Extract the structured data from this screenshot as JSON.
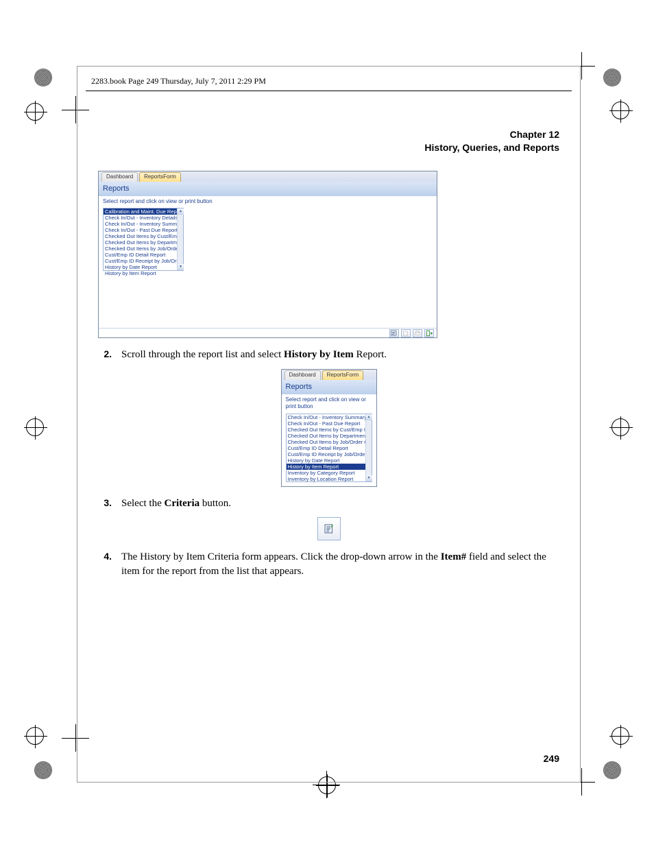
{
  "book_header": "2283.book  Page 249  Thursday, July 7, 2011  2:29 PM",
  "chapter_num": "Chapter 12",
  "chapter_title": "History, Queries, and Reports",
  "page_num": "249",
  "step2": {
    "num": "2.",
    "pre": "Scroll through the report list and select ",
    "bold": "History by Item",
    "post": " Report."
  },
  "step3": {
    "num": "3.",
    "pre": "Select the ",
    "bold": "Criteria",
    "post": " button."
  },
  "step4": {
    "num": "4.",
    "text_a": "The History by Item Criteria form appears. Click the drop-down arrow in the ",
    "bold": "Item#",
    "text_b": " field and select the item for the report from the list that appears."
  },
  "shot": {
    "tab_dashboard": "Dashboard",
    "tab_reports": "ReportsForm",
    "title": "Reports",
    "instruction": "Select report and click on view or print button",
    "list1": [
      "Calibration and Maint. Due Report",
      "Check In/Out - Inventory Details",
      "Check In/Out - Inventory Summary",
      "Check In/Out - Past Due Report",
      "Checked Out Items by Cust/Emp ID",
      "Checked Out Items by Department",
      "Checked Out Items by Job/Order #",
      "Cust/Emp ID Detail Report",
      "Cust/Emp ID Receipt by Job/Order#",
      "History by Date Report",
      "History by Item Report"
    ],
    "list1_selected": 0,
    "list2": [
      "Check In/Out - Inventory Summary",
      "Check In/Out - Past Due Report",
      "Checked Out Items by Cust/Emp ID",
      "Checked Out Items by Department",
      "Checked Out Items by Job/Order #",
      "Cust/Emp ID Detail Report",
      "Cust/Emp ID Receipt by Job/Order#",
      "History by Date Report",
      "History by Item Report",
      "Inventory by Category Report",
      "Inventory by Location Report"
    ],
    "list2_selected": 8
  }
}
